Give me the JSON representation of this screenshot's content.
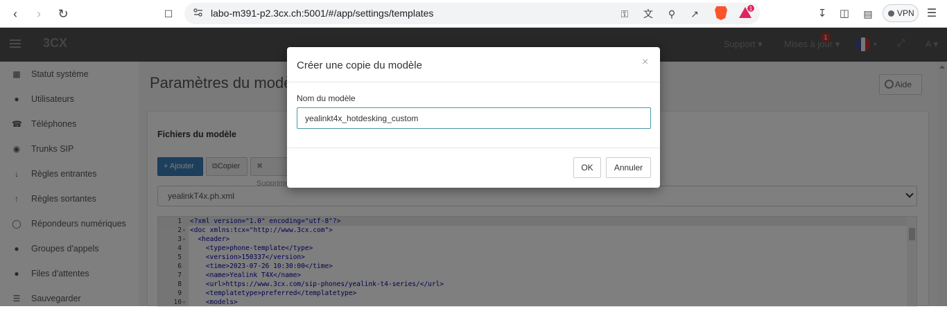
{
  "browser": {
    "url": "labo-m391-p2.3cx.ch:5001/#/app/settings/templates",
    "vpn_label": "VPN",
    "bat_badge": "1"
  },
  "header": {
    "logo": "3CX",
    "support": "Support",
    "updates": "Mises à jour",
    "updates_badge": "1",
    "user": "A"
  },
  "sidebar": {
    "items": [
      {
        "icon": "bar-chart-icon",
        "label": "Statut système"
      },
      {
        "icon": "user-icon",
        "label": "Utilisateurs"
      },
      {
        "icon": "phone-icon",
        "label": "Téléphones"
      },
      {
        "icon": "globe-icon",
        "label": "Trunks SIP"
      },
      {
        "icon": "arrow-down-icon",
        "label": "Règles entrantes"
      },
      {
        "icon": "arrow-up-icon",
        "label": "Règles sortantes"
      },
      {
        "icon": "headset-icon",
        "label": "Répondeurs numériques"
      },
      {
        "icon": "users-icon",
        "label": "Groupes d'appels"
      },
      {
        "icon": "queue-icon",
        "label": "Files d'attentes"
      },
      {
        "icon": "database-icon",
        "label": "Sauvegarder"
      }
    ]
  },
  "main": {
    "page_title": "Paramètres du modèle",
    "help_label": "Aide",
    "panel_title": "Fichiers du modèle",
    "toolbar": {
      "add_label": "Ajouter",
      "copy_label": "Copier",
      "delete_label": "Supprimer"
    },
    "selected_file": "yealinkT4x.ph.xml",
    "code_lines": [
      {
        "n": "1",
        "fold": "",
        "text": "<?xml version=\"1.0\" encoding=\"utf-8\"?>"
      },
      {
        "n": "2",
        "fold": "▾",
        "text": "<doc xmlns:tcx=\"http://www.3cx.com\">"
      },
      {
        "n": "3",
        "fold": "▾",
        "text": "  <header>"
      },
      {
        "n": "4",
        "fold": "",
        "text": "    <type>phone-template</type>"
      },
      {
        "n": "5",
        "fold": "",
        "text": "    <version>150337</version>"
      },
      {
        "n": "6",
        "fold": "",
        "text": "    <time>2023-07-26 10:30:00</time>"
      },
      {
        "n": "7",
        "fold": "",
        "text": "    <name>Yealink T4X</name>"
      },
      {
        "n": "8",
        "fold": "",
        "text": "    <url>https://www.3cx.com/sip-phones/yealink-t4-series/</url>"
      },
      {
        "n": "9",
        "fold": "",
        "text": "    <templatetype>preferred</templatetype>"
      },
      {
        "n": "10",
        "fold": "▾",
        "text": "    <models>"
      }
    ]
  },
  "modal": {
    "title": "Créer une copie du modèle",
    "close": "×",
    "field_label": "Nom du modèle",
    "field_value": "yealinkt4x_hotdesking_custom",
    "ok_label": "OK",
    "cancel_label": "Annuler"
  },
  "colors": {
    "accent": "#3a7fb8",
    "header_bg": "#515151",
    "brave": "#fb542b"
  }
}
